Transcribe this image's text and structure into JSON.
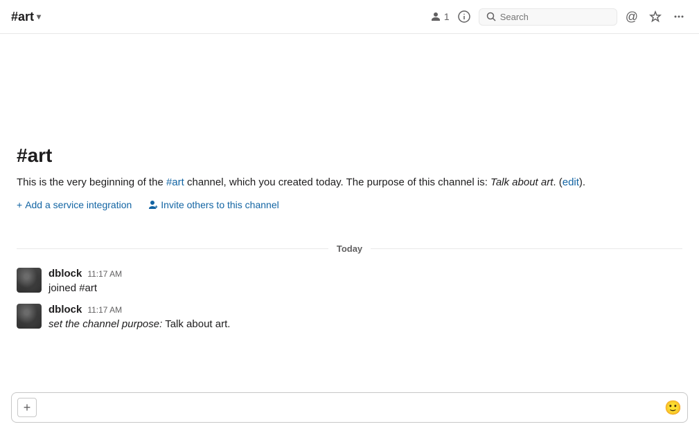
{
  "header": {
    "channel_name": "#art",
    "chevron": "▾",
    "member_count": "1",
    "member_icon": "👤",
    "search_placeholder": "Search",
    "info_icon": "ⓘ",
    "mention_icon": "@",
    "star_icon": "☆",
    "more_icon": "•••"
  },
  "channel_intro": {
    "title": "#art",
    "description_prefix": "This is the very beginning of the ",
    "channel_link": "#art",
    "description_middle": " channel, which you created today. The purpose of this channel is: ",
    "purpose_italic": "Talk about art",
    "description_suffix": ".",
    "edit_link": "edit",
    "actions": [
      {
        "id": "add-integration",
        "icon": "+",
        "label": "Add a service integration"
      },
      {
        "id": "invite-others",
        "icon": "👤",
        "label": "Invite others to this channel"
      }
    ]
  },
  "today_divider": {
    "label": "Today"
  },
  "messages": [
    {
      "id": "msg1",
      "author": "dblock",
      "time": "11:17 AM",
      "body_italic": null,
      "body": "joined #art"
    },
    {
      "id": "msg2",
      "author": "dblock",
      "time": "11:17 AM",
      "body_italic": "set the channel purpose:",
      "body": " Talk about art."
    }
  ],
  "message_input": {
    "add_label": "+",
    "placeholder": "",
    "emoji_label": "🙂"
  }
}
